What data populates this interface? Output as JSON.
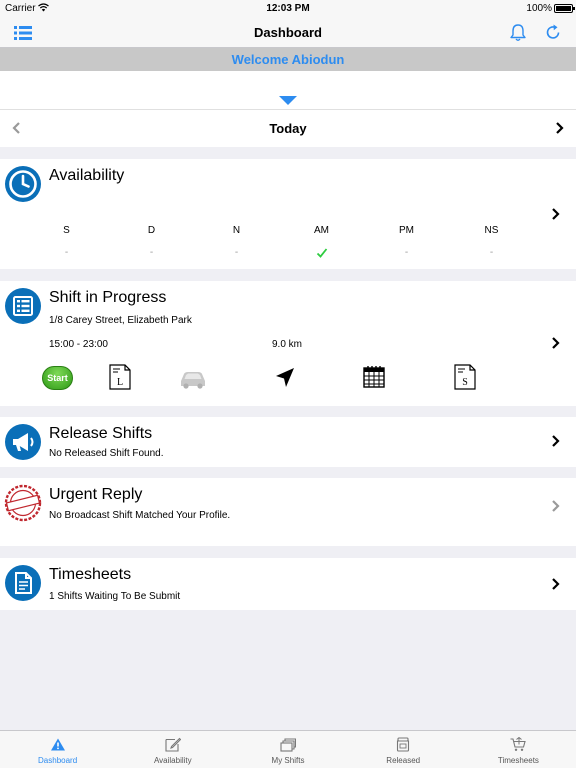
{
  "status_bar": {
    "carrier": "Carrier",
    "time": "12:03 PM",
    "battery": "100%"
  },
  "nav": {
    "title": "Dashboard"
  },
  "welcome": "Welcome Abiodun",
  "date_nav": {
    "label": "Today"
  },
  "availability": {
    "title": "Availability",
    "columns": [
      {
        "code": "S",
        "value": "-"
      },
      {
        "code": "D",
        "value": "-"
      },
      {
        "code": "N",
        "value": "-"
      },
      {
        "code": "AM",
        "value": "",
        "checked": true
      },
      {
        "code": "PM",
        "value": "-"
      },
      {
        "code": "NS",
        "value": "-"
      }
    ]
  },
  "shift": {
    "title": "Shift in Progress",
    "address": "1/8 Carey Street, Elizabeth Park",
    "time": "15:00 - 23:00",
    "distance": "9.0 km",
    "start_label": "Start",
    "leave_icon_letter": "L",
    "sheet_icon_letter": "S"
  },
  "release": {
    "title": "Release Shifts",
    "subtitle": "No Released Shift Found."
  },
  "urgent": {
    "title": "Urgent Reply",
    "subtitle": "No Broadcast Shift Matched Your Profile.",
    "stamp_text": "URGENT"
  },
  "timesheets": {
    "title": "Timesheets",
    "subtitle": "1 Shifts Waiting To Be Submit"
  },
  "tabs": [
    {
      "label": "Dashboard",
      "icon": "warning-icon",
      "active": true
    },
    {
      "label": "Availability",
      "icon": "edit-icon"
    },
    {
      "label": "My Shifts",
      "icon": "stack-icon"
    },
    {
      "label": "Released",
      "icon": "jar-icon"
    },
    {
      "label": "Timesheets",
      "icon": "cart-icon"
    }
  ],
  "colors": {
    "accent": "#2d8cf0",
    "circle_blue": "#0a6fb8",
    "check_green": "#2ecc40",
    "urgent_red": "#c0282f"
  }
}
